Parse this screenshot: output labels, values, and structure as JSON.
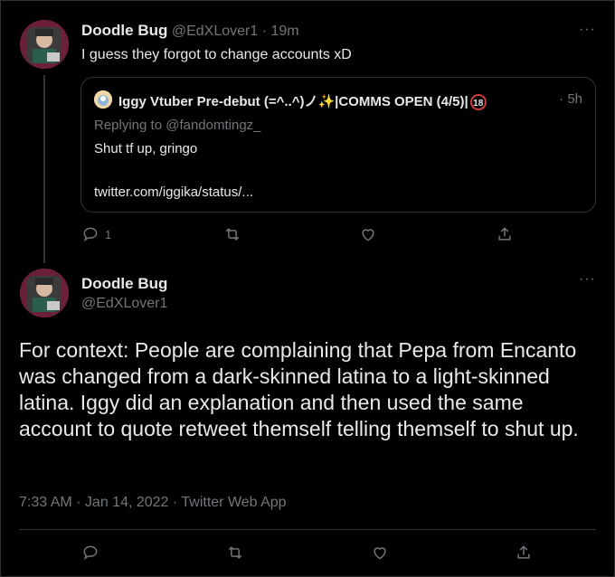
{
  "reply_tweet": {
    "author_name": "Doodle Bug",
    "author_handle": "@EdXLover1",
    "time": "19m",
    "text": "I guess they forgot to change accounts xD",
    "reply_count": "1"
  },
  "quoted_tweet": {
    "author_name": "Iggy Vtuber Pre-debut (=^..^)ノ✨|COMMS OPEN (4/5)|",
    "badge": "18",
    "time": "5h",
    "replying_to": "Replying to @fandomtingz_",
    "text": "Shut tf up, gringo",
    "link": "twitter.com/iggika/status/..."
  },
  "main_tweet": {
    "author_name": "Doodle Bug",
    "author_handle": "@EdXLover1",
    "text": "For context: People are complaining that Pepa from Encanto was changed from a dark-skinned latina to a light-skinned latina. Iggy did an explanation and then used the same account to quote retweet themself telling themself to shut up.",
    "timestamp": "7:33 AM · Jan 14, 2022 · Twitter Web App"
  },
  "colors": {
    "background": "#000000",
    "text": "#e7e9ea",
    "muted": "#71767b",
    "border": "#2f3336",
    "avatar_bg": "#6b1f3a"
  },
  "icons": [
    "more-icon",
    "reply-icon",
    "retweet-icon",
    "like-icon",
    "share-icon"
  ]
}
